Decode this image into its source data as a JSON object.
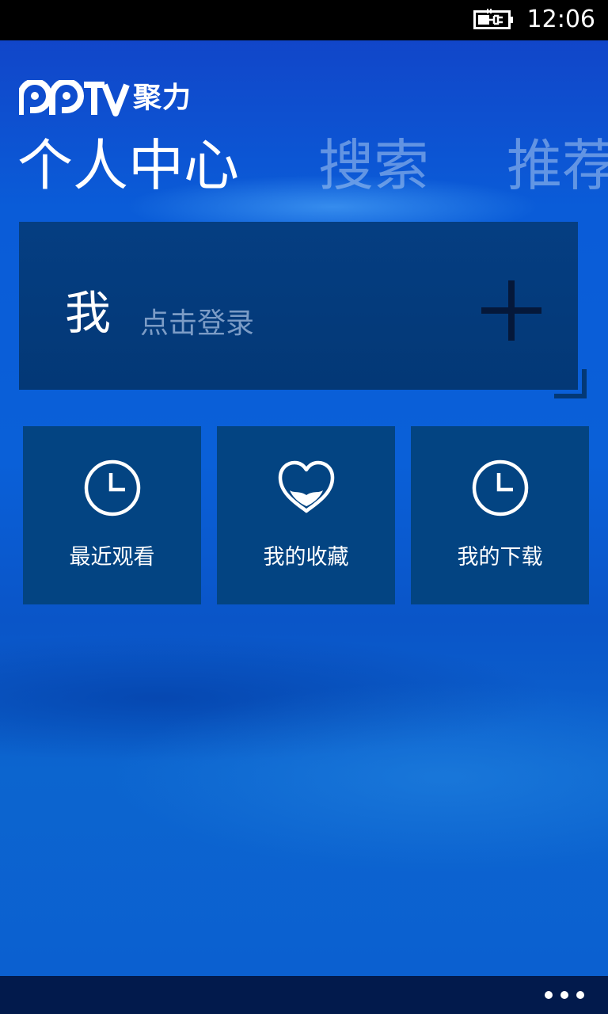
{
  "status_bar": {
    "time": "12:06",
    "battery_icon": "battery-charging-icon"
  },
  "app": {
    "logo_text": "聚力"
  },
  "pivot": {
    "items": [
      {
        "label": "个人中心",
        "active": true
      },
      {
        "label": "搜索",
        "active": false
      },
      {
        "label": "推荐",
        "active": false
      }
    ]
  },
  "login_tile": {
    "title": "我",
    "hint": "点击登录",
    "action_icon": "plus-icon"
  },
  "tiles": [
    {
      "label": "最近观看",
      "icon": "clock-icon"
    },
    {
      "label": "我的收藏",
      "icon": "heart-icon"
    },
    {
      "label": "我的下载",
      "icon": "clock-icon"
    }
  ],
  "app_bar": {
    "more_icon": "ellipsis-icon"
  },
  "colors": {
    "background": "#0a5cd8",
    "tile": "#034482",
    "login_tile": "#033a7a",
    "app_bar": "#021a4c",
    "inactive_pivot": "#8fb0e0"
  }
}
